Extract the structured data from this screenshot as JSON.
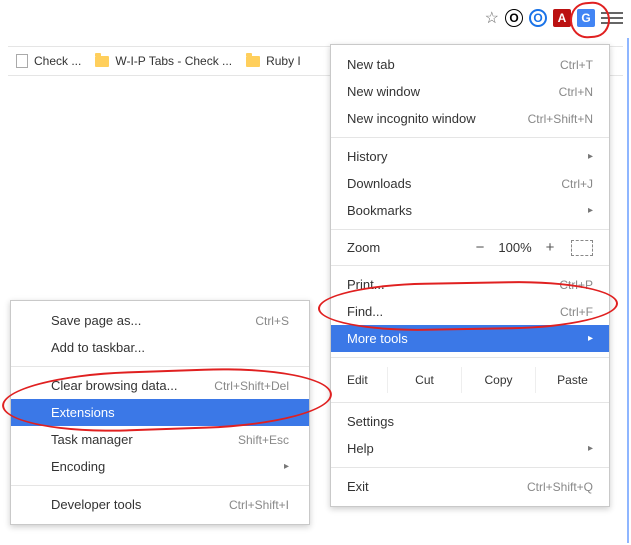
{
  "toolbar": {
    "star_aria": "Bookmark this page",
    "ext": {
      "o1": "O",
      "o2": "O",
      "pdf": "A",
      "g": "G"
    },
    "hamburger_aria": "Customize and control Google Chrome"
  },
  "bookmarks": {
    "b1": "Check ...",
    "b2": "W-I-P Tabs - Check ...",
    "b3": "Ruby I"
  },
  "menu": {
    "new_tab": {
      "label": "New tab",
      "shortcut": "Ctrl+T"
    },
    "new_window": {
      "label": "New window",
      "shortcut": "Ctrl+N"
    },
    "incognito": {
      "label": "New incognito window",
      "shortcut": "Ctrl+Shift+N"
    },
    "history": {
      "label": "History",
      "arrow": "▸"
    },
    "downloads": {
      "label": "Downloads",
      "shortcut": "Ctrl+J"
    },
    "bookmarks": {
      "label": "Bookmarks",
      "arrow": "▸"
    },
    "zoom": {
      "label": "Zoom",
      "minus": "−",
      "pct": "100%",
      "plus": "+"
    },
    "print": {
      "label": "Print...",
      "shortcut": "Ctrl+P"
    },
    "find": {
      "label": "Find...",
      "shortcut": "Ctrl+F"
    },
    "more_tools": {
      "label": "More tools",
      "arrow": "▸"
    },
    "edit": {
      "label": "Edit",
      "cut": "Cut",
      "copy": "Copy",
      "paste": "Paste"
    },
    "settings": {
      "label": "Settings"
    },
    "help": {
      "label": "Help",
      "arrow": "▸"
    },
    "exit": {
      "label": "Exit",
      "shortcut": "Ctrl+Shift+Q"
    }
  },
  "submenu": {
    "save_as": {
      "label": "Save page as...",
      "shortcut": "Ctrl+S"
    },
    "taskbar": {
      "label": "Add to taskbar..."
    },
    "clear": {
      "label": "Clear browsing data...",
      "shortcut": "Ctrl+Shift+Del"
    },
    "extensions": {
      "label": "Extensions"
    },
    "taskmgr": {
      "label": "Task manager",
      "shortcut": "Shift+Esc"
    },
    "encoding": {
      "label": "Encoding",
      "arrow": "▸"
    },
    "devtools": {
      "label": "Developer tools",
      "shortcut": "Ctrl+Shift+I"
    }
  }
}
